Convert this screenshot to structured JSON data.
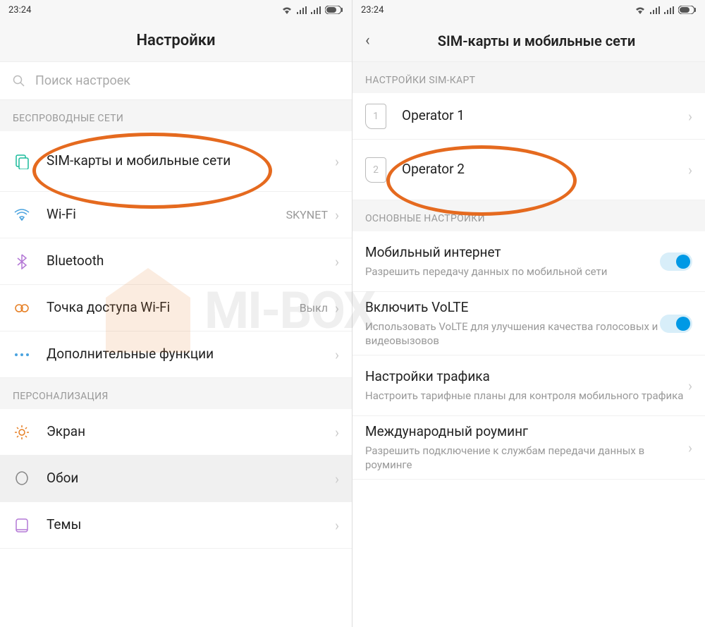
{
  "status": {
    "time": "23:24"
  },
  "left": {
    "title": "Настройки",
    "search_placeholder": "Поиск настроек",
    "section_wireless": "БЕСПРОВОДНЫЕ СЕТИ",
    "section_personalization": "ПЕРСОНАЛИЗАЦИЯ",
    "sim": "SIM-карты и мобильные сети",
    "wifi": "Wi-Fi",
    "wifi_value": "SKYNET",
    "bluetooth": "Bluetooth",
    "hotspot": "Точка доступа Wi-Fi",
    "hotspot_value": "Выкл",
    "more": "Дополнительные функции",
    "screen": "Экран",
    "wallpaper": "Обои",
    "themes": "Темы"
  },
  "right": {
    "title": "SIM-карты и мобильные сети",
    "section_sim": "НАСТРОЙКИ SIM-КАРТ",
    "section_main": "ОСНОВНЫЕ НАСТРОЙКИ",
    "op1": "Operator 1",
    "op2": "Operator 2",
    "sim1_num": "1",
    "sim2_num": "2",
    "mobile_data": "Мобильный интернет",
    "mobile_data_desc": "Разрешить передачу данных по мобильной сети",
    "volte": "Включить VoLTE",
    "volte_desc": "Использовать VoLTE для улучшения качества голосовых и видеовызовов",
    "traffic": "Настройки трафика",
    "traffic_desc": "Настроить тарифные планы для контроля мобильного трафика",
    "roaming": "Международный роуминг",
    "roaming_desc": "Разрешить подключение к службам передачи данных в роуминге"
  },
  "watermark": "MI-BOX"
}
